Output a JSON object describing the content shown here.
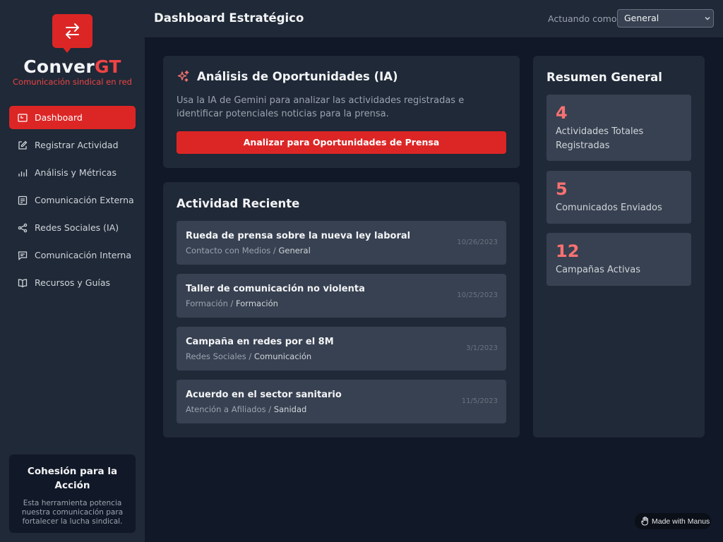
{
  "brand": {
    "name_main": "Conver",
    "name_accent": "GT",
    "tagline": "Comunicación sindical en red"
  },
  "nav": [
    {
      "label": "Dashboard",
      "icon": "dashboard-icon",
      "active": true
    },
    {
      "label": "Registrar Actividad",
      "icon": "edit-icon",
      "active": false
    },
    {
      "label": "Análisis y Métricas",
      "icon": "bar-chart-icon",
      "active": false
    },
    {
      "label": "Comunicación Externa",
      "icon": "newspaper-icon",
      "active": false
    },
    {
      "label": "Redes Sociales (IA)",
      "icon": "share-icon",
      "active": false
    },
    {
      "label": "Comunicación Interna",
      "icon": "message-icon",
      "active": false
    },
    {
      "label": "Recursos y Guías",
      "icon": "book-icon",
      "active": false
    }
  ],
  "side_card": {
    "title": "Cohesión para la Acción",
    "text": "Esta herramienta potencia nuestra comunicación para fortalecer la lucha sindical."
  },
  "header": {
    "title": "Dashboard Estratégico",
    "acting_label": "Actuando como:",
    "role_value": "General"
  },
  "ai_card": {
    "title": "Análisis de Oportunidades (IA)",
    "description": "Usa la IA de Gemini para analizar las actividades registradas e identificar potenciales noticias para la prensa.",
    "button": "Analizar para Oportunidades de Prensa"
  },
  "recent": {
    "title": "Actividad Reciente",
    "items": [
      {
        "title": "Rueda de prensa sobre la nueva ley laboral",
        "category": "Contacto con Medios",
        "department": "General",
        "date": "10/26/2023"
      },
      {
        "title": "Taller de comunicación no violenta",
        "category": "Formación",
        "department": "Formación",
        "date": "10/25/2023"
      },
      {
        "title": "Campaña en redes por el 8M",
        "category": "Redes Sociales",
        "department": "Comunicación",
        "date": "3/1/2023"
      },
      {
        "title": "Acuerdo en el sector sanitario",
        "category": "Atención a Afiliados",
        "department": "Sanidad",
        "date": "11/5/2023"
      }
    ]
  },
  "summary": {
    "title": "Resumen General",
    "stats": [
      {
        "value": "4",
        "label": "Actividades Totales Registradas"
      },
      {
        "value": "5",
        "label": "Comunicados Enviados"
      },
      {
        "value": "12",
        "label": "Campañas Activas"
      }
    ]
  },
  "badge": {
    "label": "Made with Manus"
  },
  "colors": {
    "accent": "#dc2626",
    "stat_number": "#f87171",
    "background": "#111827",
    "panel": "#1f2937"
  }
}
